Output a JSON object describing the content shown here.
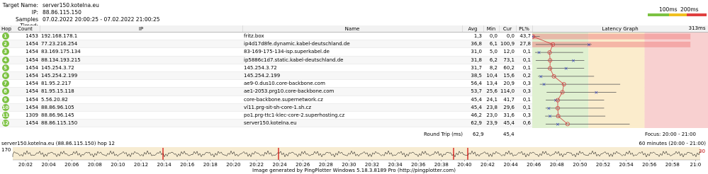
{
  "header": {
    "target_label": "Target Name:",
    "target_value": "server150.kotelna.eu",
    "ip_label": "IP:",
    "ip_value": "88.86.115.150",
    "samples_label": "Samples Timed:",
    "samples_value": "07.02.2022 20:00:25 - 07.02.2022 21:00:25"
  },
  "legend": {
    "t1": "100ms",
    "t2": "200ms",
    "colors": [
      "#7cc242",
      "#f0c020",
      "#e04040"
    ]
  },
  "columns": {
    "hop": "Hop",
    "count": "Count",
    "ip": "IP",
    "name": "Name",
    "avg": "Avg",
    "min": "Min",
    "cur": "Cur",
    "pl": "PL%",
    "graph": "Latency Graph",
    "graph_max": "313ms"
  },
  "rows": [
    {
      "hop": "1",
      "count": "1453",
      "ip": "192.168.178.1",
      "name": "fritz.box",
      "avg": "1,3",
      "min": "0,0",
      "cur": "0,0",
      "pl": "43,7"
    },
    {
      "hop": "2",
      "count": "1454",
      "ip": "77.23.216.254",
      "name": "ip4d17d8fe.dynamic.kabel-deutschland.de",
      "avg": "36,8",
      "min": "6,1",
      "cur": "100,9",
      "pl": "27,8"
    },
    {
      "hop": "3",
      "count": "1454",
      "ip": "83.169.175.134",
      "name": "83-169-175-134-isp.superkabel.de",
      "avg": "31,0",
      "min": "5,0",
      "cur": "12,0",
      "pl": "0,1"
    },
    {
      "hop": "4",
      "count": "1454",
      "ip": "88.134.193.215",
      "name": "ip5886c1d7.static.kabel-deutschland.de",
      "avg": "31,8",
      "min": "6,2",
      "cur": "73,1",
      "pl": "0,1"
    },
    {
      "hop": "5",
      "count": "1454",
      "ip": "145.254.3.72",
      "name": "145.254.3.72",
      "avg": "31,7",
      "min": "8,2",
      "cur": "60,2",
      "pl": "0,1"
    },
    {
      "hop": "6",
      "count": "1454",
      "ip": "145.254.2.199",
      "name": "145.254.2.199",
      "avg": "38,5",
      "min": "10,4",
      "cur": "15,6",
      "pl": "0,2"
    },
    {
      "hop": "7",
      "count": "1454",
      "ip": "81.95.2.217",
      "name": "ae9-0.dus10.core-backbone.com",
      "avg": "56,4",
      "min": "13,4",
      "cur": "20,9",
      "pl": "0,3"
    },
    {
      "hop": "8",
      "count": "1454",
      "ip": "81.95.15.118",
      "name": "ae1-2053.prg10.core-backbone.com",
      "avg": "53,7",
      "min": "25,6",
      "cur": "114,0",
      "pl": "0,3"
    },
    {
      "hop": "9",
      "count": "1454",
      "ip": "5.56.20.82",
      "name": "core-backbone.supernetwork.cz",
      "avg": "45,4",
      "min": "24,1",
      "cur": "41,7",
      "pl": "0,1"
    },
    {
      "hop": "10",
      "count": "1454",
      "ip": "88.86.96.105",
      "name": "vl11.prg-sit-sh-core-1.sh.cz",
      "avg": "45,4",
      "min": "23,8",
      "cur": "29,6",
      "pl": "0,1"
    },
    {
      "hop": "11",
      "count": "1309",
      "ip": "88.86.96.145",
      "name": "po1.prg-ttc1-klec-core-2.superhosting.cz",
      "avg": "46,2",
      "min": "23,0",
      "cur": "31,6",
      "pl": "0,3"
    },
    {
      "hop": "12",
      "count": "1454",
      "ip": "88.86.115.150",
      "name": "server150.kotelna.eu",
      "avg": "62,9",
      "min": "23,9",
      "cur": "45,4",
      "pl": "0,6"
    }
  ],
  "roundtrip": {
    "label": "Round Trip (ms)",
    "avg": "62,9",
    "cur": "45,4",
    "focus": "Focus: 20:00 - 21:00"
  },
  "timeline": {
    "title": "server150.kotelna.eu (88.86.115.150) hop 12",
    "range": "60 minutes (20:00 - 21:00)",
    "ymax": "170",
    "yright": "30",
    "ticks": [
      "20:02",
      "20:04",
      "20:06",
      "20:08",
      "20:10",
      "20:12",
      "20:14",
      "20:16",
      "20:18",
      "20:20",
      "20:22",
      "20:24",
      "20:26",
      "20:28",
      "20:30",
      "20:32",
      "20:34",
      "20:36",
      "20:38",
      "20:40",
      "20:42",
      "20:44",
      "20:46",
      "20:48",
      "20:50",
      "20:52",
      "20:54",
      "20:56",
      "20:58",
      "21:0"
    ]
  },
  "footer": "Image generated by PingPlotter Windows 5.18.3.8189 Pro (http://pingplotter.com)"
}
